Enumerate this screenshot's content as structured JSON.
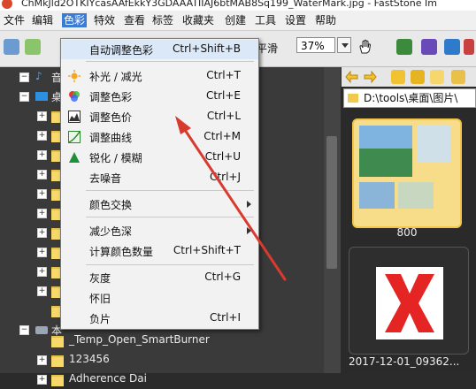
{
  "window": {
    "title": "ChMkJld2OTKIYcasAAfEkkY3GDAAATIIAJ6btMAB8Sq199_WaterMark.jpg - FastStone Im"
  },
  "menubar": {
    "items": [
      "文件",
      "编辑",
      "色彩",
      "特效",
      "查看",
      "标签",
      "收藏夹",
      "创建",
      "工具",
      "设置",
      "帮助"
    ],
    "active": "色彩"
  },
  "toolbar": {
    "smooth_label": "平滑",
    "zoom_value": "37%"
  },
  "tree": {
    "rows": [
      {
        "label": "音",
        "kind": "music"
      },
      {
        "label": "桌",
        "kind": "desktop"
      },
      {
        "label": "",
        "kind": "folder"
      },
      {
        "label": "",
        "kind": "folder"
      },
      {
        "label": "",
        "kind": "folder"
      },
      {
        "label": "",
        "kind": "folder"
      },
      {
        "label": "",
        "kind": "folder"
      },
      {
        "label": "",
        "kind": "folder"
      },
      {
        "label": "",
        "kind": "folder"
      },
      {
        "label": "",
        "kind": "folder"
      },
      {
        "label": "",
        "kind": "folder"
      },
      {
        "label": "",
        "kind": "folder"
      },
      {
        "label": "",
        "kind": "folder"
      },
      {
        "label": "本",
        "kind": "drive"
      },
      {
        "label": "_Temp_Open_SmartBurner",
        "kind": "folder"
      },
      {
        "label": "123456",
        "kind": "folder"
      },
      {
        "label": "Adherence Dai",
        "kind": "folder"
      }
    ]
  },
  "browser": {
    "path": "D:\\tools\\桌面\\图片\\",
    "thumbs": [
      {
        "caption": "800"
      },
      {
        "caption": "2017-12-01_09362..."
      }
    ]
  },
  "color_menu": {
    "items": [
      {
        "label": "自动调整色彩",
        "shortcut": "Ctrl+Shift+B",
        "icon": "auto-color-icon"
      },
      {
        "label": "补光 / 减光",
        "shortcut": "Ctrl+T",
        "icon": "sun-icon"
      },
      {
        "label": "调整色彩",
        "shortcut": "Ctrl+E",
        "icon": "rgb-icon"
      },
      {
        "label": "调整色价",
        "shortcut": "Ctrl+L",
        "icon": "levels-icon"
      },
      {
        "label": "调整曲线",
        "shortcut": "Ctrl+M",
        "icon": "curves-icon"
      },
      {
        "label": "锐化 / 模糊",
        "shortcut": "Ctrl+U",
        "icon": "sharpen-icon"
      },
      {
        "label": "去噪音",
        "shortcut": "Ctrl+J",
        "icon": ""
      },
      {
        "label": "颜色交换",
        "shortcut": "",
        "icon": "",
        "submenu": true
      },
      {
        "label": "减少色深",
        "shortcut": "",
        "icon": "",
        "submenu": true
      },
      {
        "label": "计算颜色数量",
        "shortcut": "Ctrl+Shift+T",
        "icon": ""
      },
      {
        "label": "灰度",
        "shortcut": "Ctrl+G",
        "icon": ""
      },
      {
        "label": "怀旧",
        "shortcut": "",
        "icon": ""
      },
      {
        "label": "负片",
        "shortcut": "Ctrl+I",
        "icon": ""
      }
    ]
  },
  "colors": {
    "accent": "#3a7bd5",
    "arrow": "#d83a2e",
    "folder": "#f6d86b",
    "tree_bg": "#3a3a3a"
  }
}
